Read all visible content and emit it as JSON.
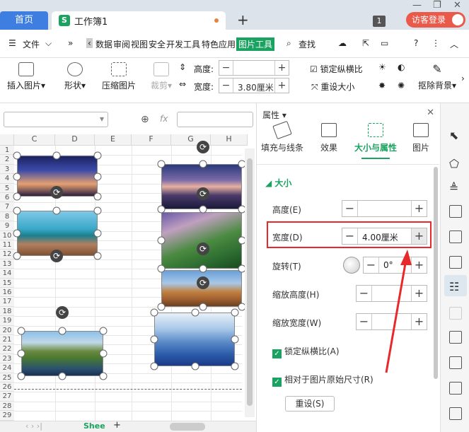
{
  "titlebar": {
    "home_tab": "首页",
    "doc_tab": "工作簿1",
    "doc_icon": "S",
    "add_tab": "+",
    "badge": "1",
    "login_button": "访客登录"
  },
  "menubar": {
    "file": "文件",
    "more": "»",
    "items": [
      "数据",
      "审阅",
      "视图",
      "安全",
      "开发工具",
      "特色应用",
      "图片工具"
    ],
    "active": "图片工具",
    "search": "查找"
  },
  "ribbon": {
    "insert_picture": "插入图片",
    "shape": "形状",
    "compress": "压缩图片",
    "crop": "裁剪",
    "height_label": "高度:",
    "height_value": "",
    "width_label": "宽度:",
    "width_value": "3.80厘米",
    "lock_ratio": "锁定纵横比",
    "reset_size": "重设大小",
    "remove_bg": "抠除背景"
  },
  "formula": {
    "fx": "fx"
  },
  "sheet": {
    "columns": [
      "C",
      "D",
      "E",
      "F",
      "G",
      "H"
    ],
    "rows": [
      "1",
      "2",
      "3",
      "4",
      "5",
      "6",
      "7",
      "8",
      "9",
      "10",
      "11",
      "12",
      "13",
      "14",
      "15",
      "16",
      "17",
      "18",
      "19",
      "20",
      "21",
      "22",
      "23",
      "24",
      "25",
      "26",
      "27",
      "28",
      "29"
    ],
    "sheet_tab": "Shee",
    "add_sheet": "+"
  },
  "panel": {
    "title": "属性",
    "tabs": [
      "填充与线条",
      "效果",
      "大小与属性",
      "图片"
    ],
    "active_tab": "大小与属性",
    "section": "大小",
    "height_label": "高度(E)",
    "height_value": "",
    "width_label": "宽度(D)",
    "width_value": "4.00厘米",
    "rotation_label": "旋转(T)",
    "rotation_value": "0°",
    "scale_height_label": "缩放高度(H)",
    "scale_height_value": "",
    "scale_width_label": "缩放宽度(W)",
    "scale_width_value": "",
    "lock_ratio": "锁定纵横比(A)",
    "relative_original": "相对于图片原始尺寸(R)",
    "reset_button": "重设(S)"
  },
  "colors": {
    "accent": "#1aa260",
    "highlight": "#e8282a",
    "home_tab": "#3d7ee0",
    "login": "#ea5a4a"
  }
}
